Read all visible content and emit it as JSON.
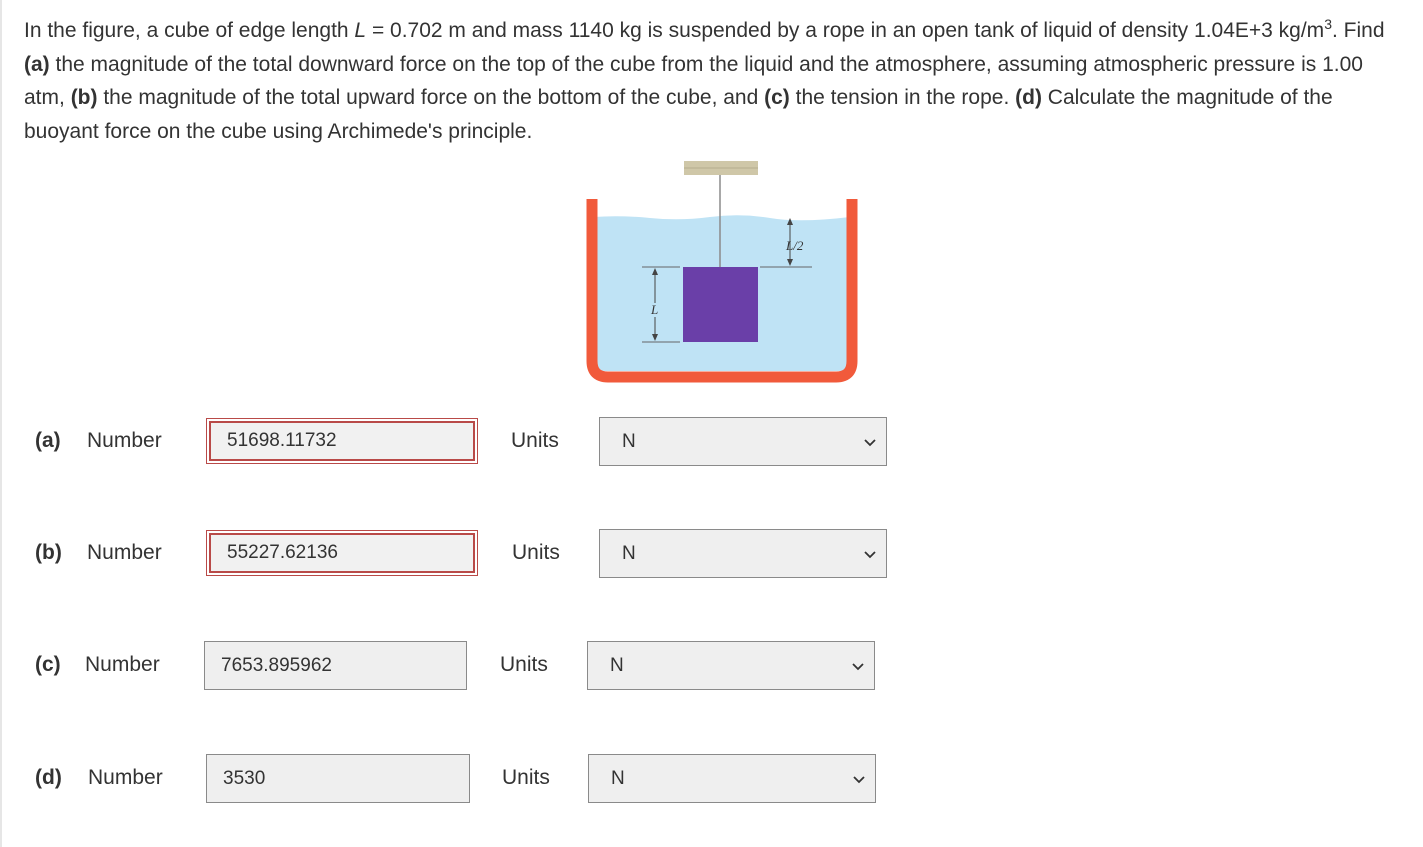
{
  "question": {
    "text_1": "In the figure, a cube of edge length ",
    "var_L": "L",
    "text_2": " = 0.702 m and mass 1140 kg is suspended by a rope in an open tank of liquid of density 1.04E+3 kg/m",
    "sup_3": "3",
    "text_3": ". Find ",
    "part_a": "(a)",
    "text_a": " the magnitude of the total downward force on the top of the cube from the liquid and the atmosphere, assuming atmospheric pressure is 1.00 atm, ",
    "part_b": "(b)",
    "text_b": " the magnitude of the total upward force on the bottom of the cube, and ",
    "part_c": "(c)",
    "text_c": " the tension in the rope. ",
    "part_d": "(d)",
    "text_d": " Calculate the magnitude of the buoyant force on the cube using Archimede's principle."
  },
  "figure": {
    "label_half": "L/2",
    "label_edge": "L",
    "colors": {
      "tank": "#f15a3b",
      "liquid": "#bfe3f5",
      "cube": "#6a3fa8",
      "support": "#cfc7a8"
    }
  },
  "answers": [
    {
      "part": "(a)",
      "number_label": "Number",
      "value": "51698.11732",
      "units_label": "Units",
      "unit": "N",
      "state": "incorrect"
    },
    {
      "part": "(b)",
      "number_label": "Number",
      "value": "55227.62136",
      "units_label": "Units",
      "unit": "N",
      "state": "incorrect"
    },
    {
      "part": "(c)",
      "number_label": "Number",
      "value": "7653.895962",
      "units_label": "Units",
      "unit": "N",
      "state": "default"
    },
    {
      "part": "(d)",
      "number_label": "Number",
      "value": "3530",
      "units_label": "Units",
      "unit": "N",
      "state": "default"
    }
  ],
  "icons": {
    "dropdown": "chevron-down-icon"
  }
}
